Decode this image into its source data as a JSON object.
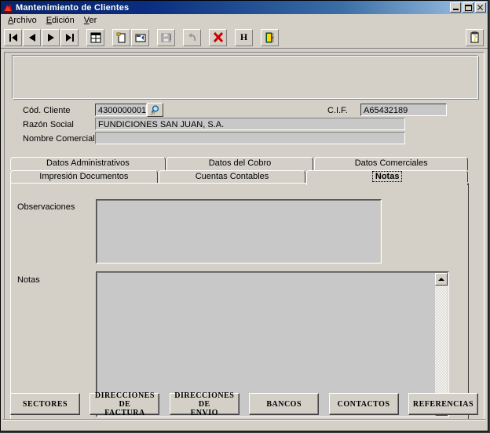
{
  "window": {
    "title": "Mantenimiento de Clientes",
    "icon": "app-icon",
    "buttons": {
      "minimize": "minimize-button",
      "maximize": "maximize-button",
      "close": "close-button"
    },
    "colors": {
      "title_left": "#08246b",
      "title_right": "#a6c8e8",
      "face": "#d4d0c8",
      "field": "#c8c8c8",
      "delete_red": "#cc0000"
    }
  },
  "menu": {
    "items": [
      {
        "label": "Archivo",
        "accel": "A"
      },
      {
        "label": "Edición",
        "accel": "E"
      },
      {
        "label": "Ver",
        "accel": "V"
      }
    ]
  },
  "toolbar": {
    "buttons": [
      {
        "name": "first-record-button",
        "icon": "first-record-icon",
        "enabled": true
      },
      {
        "name": "previous-record-button",
        "icon": "previous-record-icon",
        "enabled": true
      },
      {
        "name": "next-record-button",
        "icon": "next-record-icon",
        "enabled": true
      },
      {
        "name": "last-record-button",
        "icon": "last-record-icon",
        "enabled": true
      },
      {
        "name": "list-view-button",
        "icon": "table-grid-icon",
        "enabled": true
      },
      {
        "name": "new-record-button",
        "icon": "new-document-icon",
        "enabled": true
      },
      {
        "name": "edit-record-button",
        "icon": "edit-record-icon",
        "enabled": true
      },
      {
        "name": "save-button",
        "icon": "floppy-save-icon",
        "enabled": false
      },
      {
        "name": "undo-button",
        "icon": "undo-arrow-icon",
        "enabled": false
      },
      {
        "name": "delete-button",
        "icon": "red-x-icon",
        "enabled": true
      },
      {
        "name": "history-button",
        "icon": "letter-h-icon",
        "label": "H",
        "enabled": true
      },
      {
        "name": "exit-button",
        "icon": "exit-door-icon",
        "enabled": true
      },
      {
        "name": "help-button",
        "icon": "help-clipboard-icon",
        "enabled": true
      }
    ]
  },
  "header": {
    "fields": [
      {
        "name": "cod-cliente",
        "label": "Cód. Cliente",
        "value": "4300000001"
      },
      {
        "name": "razon-social",
        "label": "Razón Social",
        "value": "FUNDICIONES SAN JUAN, S.A."
      },
      {
        "name": "nombre-comercial",
        "label": "Nombre Comercial",
        "value": ""
      },
      {
        "name": "cif",
        "label": "C.I.F.",
        "value": "A65432189"
      }
    ],
    "lookup_button": {
      "name": "cod-cliente-lookup-button",
      "icon": "magnifier-icon"
    }
  },
  "tabs": {
    "row1": [
      {
        "label": "Datos Administrativos",
        "active": false
      },
      {
        "label": "Datos del Cobro",
        "active": false
      },
      {
        "label": "Datos Comerciales",
        "active": false
      }
    ],
    "row2": [
      {
        "label": "Impresión Documentos",
        "active": false
      },
      {
        "label": "Cuentas Contables",
        "active": false
      },
      {
        "label": "Notas",
        "active": true
      }
    ]
  },
  "notas_panel": {
    "observaciones": {
      "label": "Observaciones",
      "value": ""
    },
    "notas": {
      "label": "Notas",
      "value": "",
      "scrollbar": {
        "up": "scroll-up-arrow",
        "down": "scroll-down-arrow"
      }
    }
  },
  "bottom_buttons": [
    {
      "name": "sectores-button",
      "label": "SECTORES"
    },
    {
      "name": "direcciones-factura-button",
      "label": "DIRECCIONES DE\nFACTURA"
    },
    {
      "name": "direcciones-envio-button",
      "label": "DIRECCIONES DE\nENVIO"
    },
    {
      "name": "bancos-button",
      "label": "BANCOS"
    },
    {
      "name": "contactos-button",
      "label": "CONTACTOS"
    },
    {
      "name": "referencias-button",
      "label": "REFERENCIAS"
    }
  ]
}
